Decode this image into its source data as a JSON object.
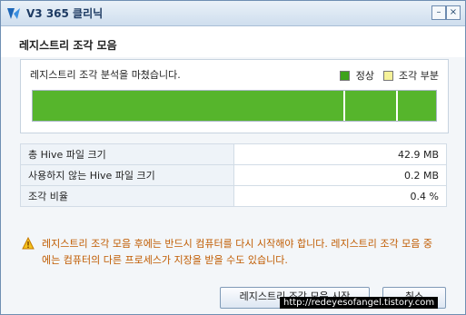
{
  "window": {
    "title": "V3 365 클리닉",
    "min_label": "–",
    "close_label": "×"
  },
  "header": {
    "title": "레지스트리 조각 모음"
  },
  "analysis": {
    "message": "레지스트리 조각 분석을 마쳤습니다.",
    "legend_normal": "정상",
    "legend_fragment": "조각 부분",
    "color_normal": "#56b52c",
    "color_fragment": "#f6f29a"
  },
  "info_table": [
    {
      "label": "총 Hive 파일 크기",
      "value": "42.9 MB"
    },
    {
      "label": "사용하지 않는 Hive 파일 크기",
      "value": "0.2 MB"
    },
    {
      "label": "조각 비율",
      "value": "0.4 %"
    }
  ],
  "warning": {
    "icon": "warning-icon",
    "text": "레지스트리 조각 모음 후에는 반드시 컴퓨터를 다시 시작해야 합니다. 레지스트리 조각 모음 중에는 컴퓨터의 다른 프로세스가 지장을 받을 수도 있습니다."
  },
  "buttons": {
    "start_label": "레지스트리 조각 모음 시작",
    "cancel_label": "취소"
  },
  "watermark": "http://redeyesofangel.tistory.com"
}
